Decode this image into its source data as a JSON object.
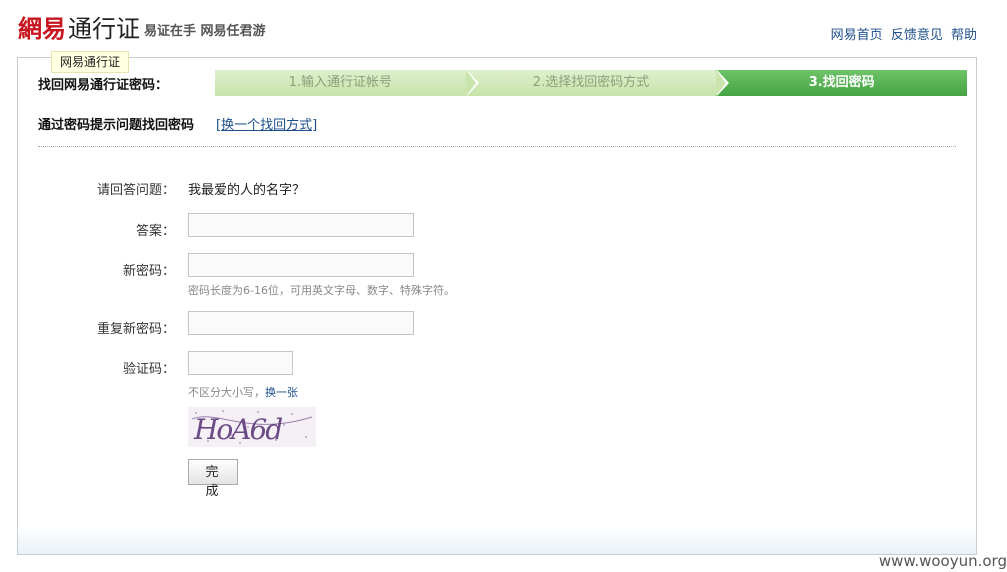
{
  "header": {
    "brand": "網易",
    "product": "通行证",
    "slogan": "易证在手 网易任君游",
    "links": [
      "网易首页",
      "反馈意见",
      "帮助"
    ]
  },
  "tooltip": "网易通行证",
  "page": {
    "title": "找回网易通行证密码：",
    "steps": [
      "1.输入通行证帐号",
      "2.选择找回密码方式",
      "3.找回密码"
    ],
    "active_step": 3,
    "subtitle": "通过密码提示问题找回密码",
    "switch_link": "[换一个找回方式]"
  },
  "form": {
    "question_label": "请回答问题：",
    "question_value": "我最爱的人的名字？",
    "answer_label": "答案：",
    "answer_value": "",
    "new_password_label": "新密码：",
    "new_password_hint": "密码长度为6-16位，可用英文字母、数字、特殊字符。",
    "repeat_password_label": "重复新密码：",
    "captcha_label": "验证码：",
    "captcha_hint": "不区分大小写，",
    "captcha_refresh": "换一张",
    "captcha_text": "HoA6d",
    "submit_label": "完 成"
  },
  "colors": {
    "brand_red": "#c8141e",
    "link_blue": "#1c4f8c",
    "step_active": "#4caa48",
    "step_done": "#c9e4ad"
  },
  "watermark": "www.wooyun.org"
}
